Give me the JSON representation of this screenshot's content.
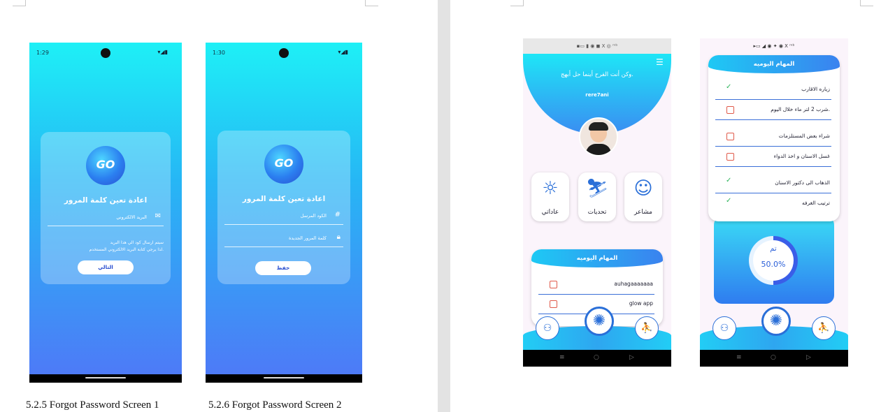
{
  "left_page": {
    "screen1": {
      "time": "1:29",
      "status_right": "▾◢▮",
      "logo": "GO",
      "title": "اعادة تعين كلمة المرور",
      "field_label": "البريد الالكتروني",
      "field_icon": "envelope-icon",
      "hint_line1": "سيتم ارسال كود الي هذا البريد",
      "hint_line2": "لذا يرجي كتابة البريد الالكتروني المستخدم.",
      "button_label": "التالي"
    },
    "screen2": {
      "time": "1:30",
      "status_right": "▾◢▮",
      "logo": "GO",
      "title": "اعادة تعين كلمة المرور",
      "field1_label": "الكود المرسل",
      "field1_icon": "hash-icon",
      "field2_label": "كلمة المرور الجديدة",
      "field2_icon": "lock-icon",
      "button_label": "حفظ"
    },
    "caption1": "5.2.5 Forgot Password Screen 1",
    "caption2": "5.2.6 Forgot Password Screen 2"
  },
  "right_page": {
    "home": {
      "status": "▪▭ ▮ ◉     ◼ X ◎ ᵐᵇ",
      "quote": "وكن أنت الفرح أينما حل أبهج.",
      "username": "rere7ani",
      "tiles": [
        {
          "label": "مشاعر",
          "icon": "emotions-icon"
        },
        {
          "label": "تحديات",
          "icon": "challenge-icon"
        },
        {
          "label": "عاداتي",
          "icon": "habits-icon"
        }
      ],
      "tasks_title": "المهام اليوميه",
      "tasks": [
        {
          "text": "auhagaaaaaaa",
          "done": false
        },
        {
          "text": "glow app",
          "done": false
        }
      ]
    },
    "tasks_screen": {
      "status": "▸▭ ◢ ◉ ✦     ◉ X ᵐᵇ",
      "tasks_title": "المهام اليوميه",
      "tasks": [
        {
          "text": "زياره الاقارب",
          "done": true
        },
        {
          "text": "شرب 2 لتر ماء خلال اليوم.",
          "done": false
        },
        {
          "text": "شراء بعض المستلزمات",
          "done": false
        },
        {
          "text": "غسل الاسنان و اخذ الدواء",
          "done": false
        },
        {
          "text": "الذهاب الى دكتور الاسنان",
          "done": true
        },
        {
          "text": "ترتيب الغرفه",
          "done": true
        }
      ],
      "progress_label": "تم",
      "progress_text": "50.0%",
      "progress_value": 0.5
    },
    "nav_glyphs": {
      "menu": "≡",
      "home": "○",
      "back": "▷"
    }
  },
  "colors": {
    "accent": "#2a6fd8",
    "gradient_top": "#1ef0f6",
    "gradient_bottom": "#4f78f7",
    "check_done": "#2bb35a",
    "check_empty": "#e05a4a"
  }
}
